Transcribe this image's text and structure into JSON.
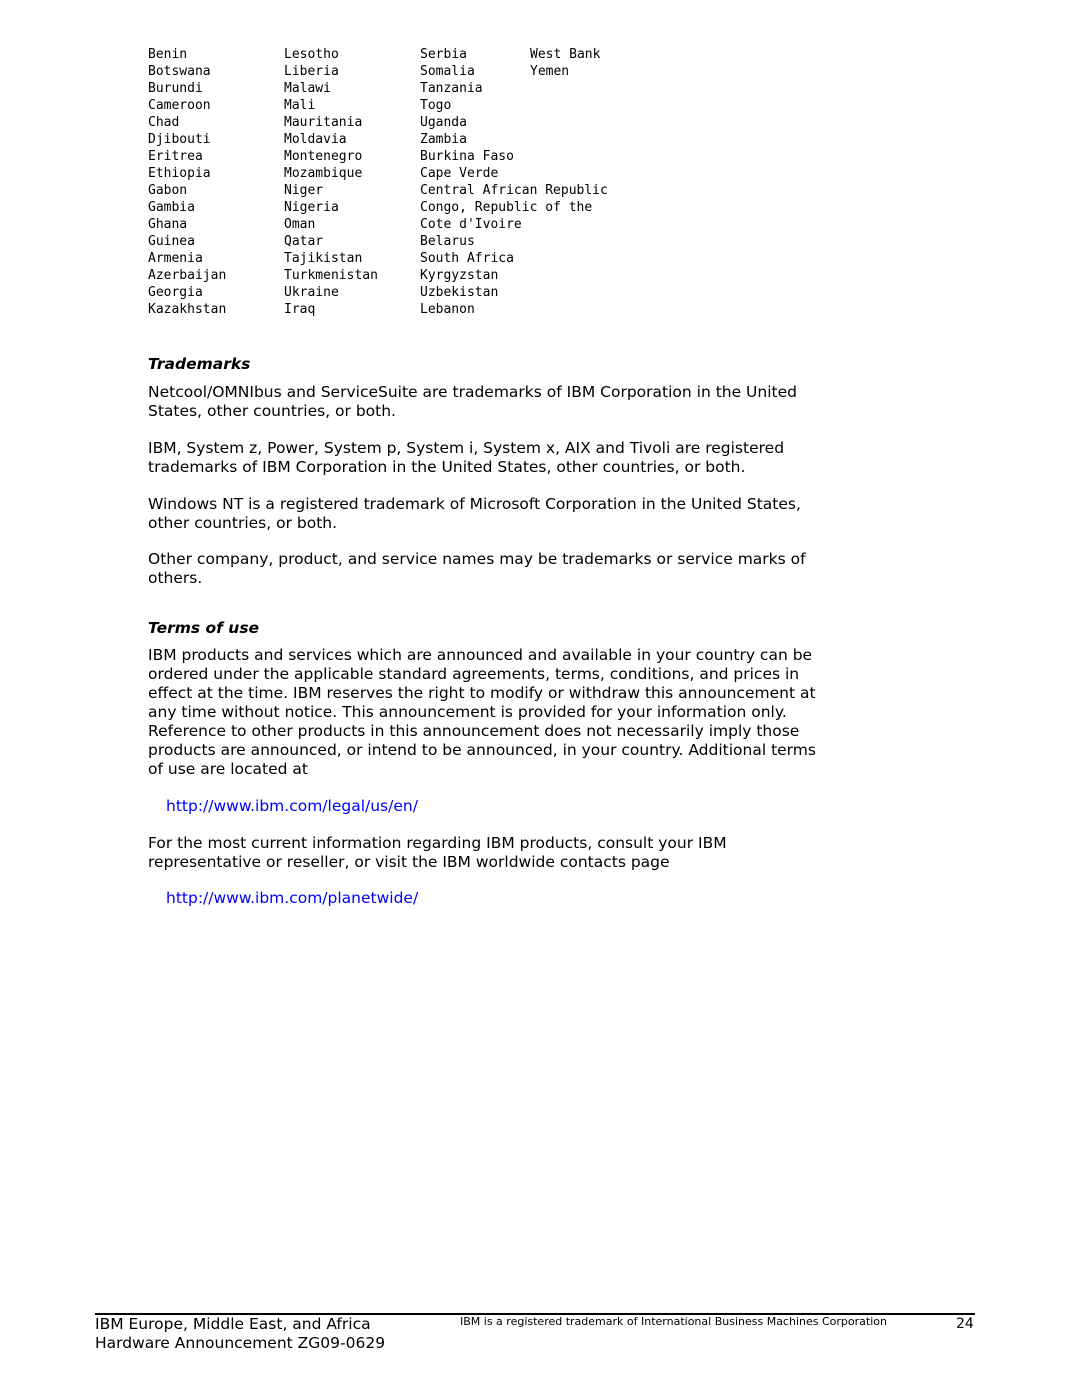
{
  "countries": {
    "rows": [
      [
        "Benin",
        "Lesotho",
        "Serbia",
        "West Bank"
      ],
      [
        "Botswana",
        "Liberia",
        "Somalia",
        "Yemen"
      ],
      [
        "Burundi",
        "Malawi",
        "Tanzania",
        ""
      ],
      [
        "Cameroon",
        "Mali",
        "Togo",
        ""
      ],
      [
        "Chad",
        "Mauritania",
        "Uganda",
        ""
      ],
      [
        "Djibouti",
        "Moldavia",
        "Zambia",
        ""
      ],
      [
        "Eritrea",
        "Montenegro",
        "Burkina Faso",
        ""
      ],
      [
        "Ethiopia",
        "Mozambique",
        "Cape Verde",
        ""
      ],
      [
        "Gabon",
        "Niger",
        "Central African Republic",
        ""
      ],
      [
        "Gambia",
        "Nigeria",
        "Congo, Republic of the",
        ""
      ],
      [
        "Ghana",
        "Oman",
        "Cote d'Ivoire",
        ""
      ],
      [
        "Guinea",
        "Qatar",
        "Belarus",
        ""
      ],
      [
        "Armenia",
        "Tajikistan",
        "South Africa",
        ""
      ],
      [
        "Azerbaijan",
        "Turkmenistan",
        "Kyrgyzstan",
        ""
      ],
      [
        "Georgia",
        "Ukraine",
        "Uzbekistan",
        ""
      ],
      [
        "Kazakhstan",
        "Iraq",
        "Lebanon",
        ""
      ]
    ]
  },
  "trademarks": {
    "heading": "Trademarks",
    "paragraphs": [
      "Netcool/OMNIbus and ServiceSuite are trademarks of IBM Corporation in the United States, other countries, or both.",
      "IBM, System z, Power, System p, System i, System x, AIX and Tivoli are registered trademarks of IBM Corporation in the United States, other countries, or both.",
      "Windows NT is a registered trademark of Microsoft Corporation in the United States, other countries, or both.",
      "Other company, product, and service names may be trademarks or service marks of others."
    ]
  },
  "terms": {
    "heading": "Terms of use",
    "paragraph1": "IBM products and services which are announced and available in your country can be ordered under the applicable standard agreements, terms, conditions, and prices in effect at the time. IBM reserves the right to modify or withdraw this announcement at any time without notice. This announcement is provided for your information only. Reference to other products in this announcement does not necessarily imply those products are announced, or intend to be announced, in your country. Additional terms of use are located at",
    "link1": "http://www.ibm.com/legal/us/en/",
    "paragraph2": "For the most current information regarding IBM products, consult your IBM representative or reseller, or visit the IBM worldwide contacts page",
    "link2": "http://www.ibm.com/planetwide/"
  },
  "footer": {
    "line1": "IBM Europe, Middle East, and Africa",
    "line2": "Hardware Announcement ZG09-0629",
    "trademark_note": "IBM is a registered trademark of International Business Machines Corporation",
    "page_number": "24"
  }
}
